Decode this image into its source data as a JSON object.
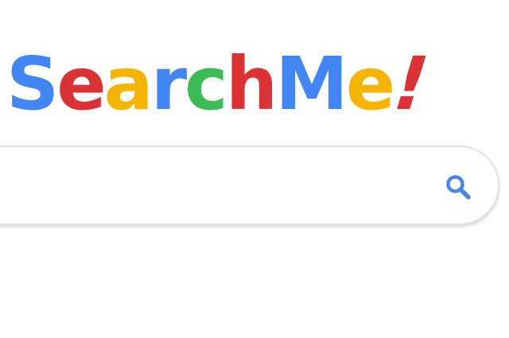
{
  "logo": {
    "letters": [
      {
        "char": "S",
        "color": "#4285F4"
      },
      {
        "char": "e",
        "color": "#DB3236"
      },
      {
        "char": "a",
        "color": "#F4B400"
      },
      {
        "char": "r",
        "color": "#4285F4"
      },
      {
        "char": "c",
        "color": "#3CBA54"
      },
      {
        "char": "h",
        "color": "#DB3236"
      },
      {
        "char": "M",
        "color": "#4285F4"
      },
      {
        "char": "e",
        "color": "#F4B400"
      },
      {
        "char": "!",
        "color": "#DB3236"
      }
    ]
  },
  "search": {
    "value": "",
    "placeholder": "",
    "icon": "search-icon",
    "icon_color": "#4A86E8"
  }
}
